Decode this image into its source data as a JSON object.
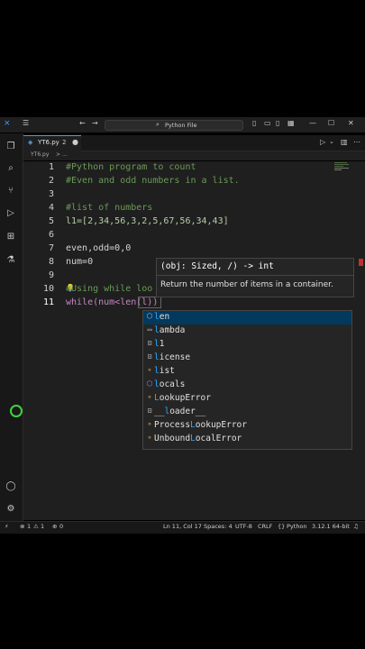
{
  "window": {
    "title": "Python File"
  },
  "tab": {
    "filename": "YT6.py",
    "problems": "2"
  },
  "breadcrumb": {
    "file": "YT6.py",
    "more": "> ..."
  },
  "editor": {
    "lines": [
      {
        "num": "1",
        "text": "#Python program to count"
      },
      {
        "num": "2",
        "text": "#Even and odd numbers in a list."
      },
      {
        "num": "3",
        "text": ""
      },
      {
        "num": "4",
        "text": "#list of numbers"
      },
      {
        "num": "5",
        "text": "l1=[2,34,56,3,2,5,67,56,34,43]"
      },
      {
        "num": "6",
        "text": ""
      },
      {
        "num": "7",
        "text": "even,odd=0,0"
      },
      {
        "num": "8",
        "text": "num=0"
      },
      {
        "num": "9",
        "text": ""
      },
      {
        "num": "10",
        "text": "#Using while loo"
      },
      {
        "num": "11",
        "text": "while(num<len(l))"
      }
    ]
  },
  "hover": {
    "signature": "(obj: Sized, /) -> int",
    "description": "Return the number of items in a container."
  },
  "suggestions": [
    {
      "icon": "function-icon",
      "label": "len",
      "match": "l"
    },
    {
      "icon": "keyword-icon",
      "label": "lambda",
      "match": "l"
    },
    {
      "icon": "variable-icon",
      "label": "l1",
      "match": "l"
    },
    {
      "icon": "variable-icon",
      "label": "license",
      "match": "l"
    },
    {
      "icon": "class-icon",
      "label": "list",
      "match": "l"
    },
    {
      "icon": "function-icon",
      "label": "locals",
      "match": "l"
    },
    {
      "icon": "class-icon",
      "label": "LookupError",
      "match": "L"
    },
    {
      "icon": "variable-icon",
      "label": "__loader__",
      "match": "l"
    },
    {
      "icon": "class-icon",
      "label": "ProcessLookupError",
      "match": "L"
    },
    {
      "icon": "class-icon",
      "label": "UnboundLocalError",
      "match": "L"
    }
  ],
  "status": {
    "errors": "1",
    "warnings": "1",
    "ports": "0",
    "position": "Ln 11, Col 17",
    "spaces": "Spaces: 4",
    "encoding": "UTF-8",
    "eol": "CRLF",
    "language": "Python",
    "interpreter": "3.12.1 64-bit"
  },
  "colors": {
    "accent": "#2aaaff",
    "comment": "#6a9955",
    "keyword": "#c586c0",
    "number": "#b5cea8",
    "background": "#1f1f1f"
  }
}
